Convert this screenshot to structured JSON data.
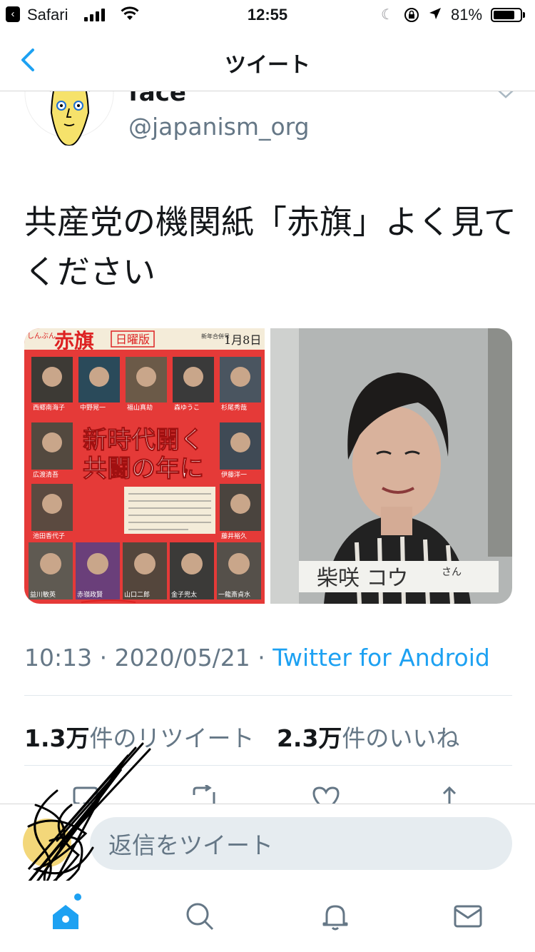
{
  "status_bar": {
    "back_app": "Safari",
    "time": "12:55",
    "battery_percent": "81%",
    "battery_level": 0.81
  },
  "nav": {
    "title": "ツイート",
    "back_icon": "chevron-left-icon"
  },
  "tweet": {
    "display_name": "face™",
    "handle": "@japanism_org",
    "text": "共産党の機関紙「赤旗」よく見てください",
    "meta": {
      "time": "10:13",
      "separator": " · ",
      "date": "2020/05/21",
      "source": "Twitter for Android"
    },
    "stats": {
      "retweets_count": "1.3万",
      "retweets_label": "件のリツイート",
      "likes_count": "2.3万",
      "likes_label": "件のいいね"
    },
    "media": {
      "left": {
        "masthead": "赤旗",
        "masthead_prefix": "しんぶん",
        "edition": "日曜版",
        "new_year": "新年合併号",
        "date": "1月8日",
        "headline_line1": "新時代開く",
        "headline_line2": "共闘の年に",
        "name_labels": [
          "西郷南海子",
          "中野晃一",
          "福山真劫",
          "森ゆうこ",
          "杉尾秀哉",
          "伊藤洋一",
          "広渡清吾",
          "池田香代子",
          "藤井裕久",
          "益川敏英",
          "赤嶺政賢",
          "山口二郎",
          "金子兜太",
          "一龍斎貞水"
        ]
      },
      "right": {
        "caption": "柴咲 コウ",
        "caption_suffix": "さん"
      }
    }
  },
  "actions": [
    "reply-icon",
    "retweet-icon",
    "like-icon",
    "share-icon"
  ],
  "reply": {
    "placeholder": "返信をツイート"
  },
  "tabs": [
    "home-icon",
    "search-icon",
    "notifications-icon",
    "messages-icon"
  ],
  "colors": {
    "accent": "#1da1f2",
    "secondary_text": "#657786",
    "primary_text": "#14171a",
    "newspaper_red": "#e0262c"
  }
}
